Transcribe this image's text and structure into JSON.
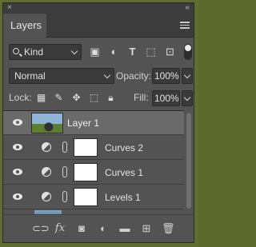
{
  "panel": {
    "title": "Layers",
    "close_glyph": "×",
    "collapse_glyph": "«"
  },
  "filter": {
    "kind_label": "Kind",
    "icons": [
      "image-filter-icon",
      "adjustment-filter-icon",
      "type-filter-icon",
      "shape-filter-icon",
      "smartobject-filter-icon"
    ]
  },
  "blend": {
    "mode": "Normal",
    "opacity_label": "Opacity:",
    "opacity_value": "100%"
  },
  "lock": {
    "label": "Lock:",
    "fill_label": "Fill:",
    "fill_value": "100%"
  },
  "layers": [
    {
      "name": "Layer 1",
      "selected": true,
      "type": "pixel"
    },
    {
      "name": "Curves 2",
      "selected": false,
      "type": "adjustment"
    },
    {
      "name": "Curves 1",
      "selected": false,
      "type": "adjustment"
    },
    {
      "name": "Levels 1",
      "selected": false,
      "type": "adjustment"
    }
  ],
  "bottom": {
    "fx_label": "fx"
  }
}
